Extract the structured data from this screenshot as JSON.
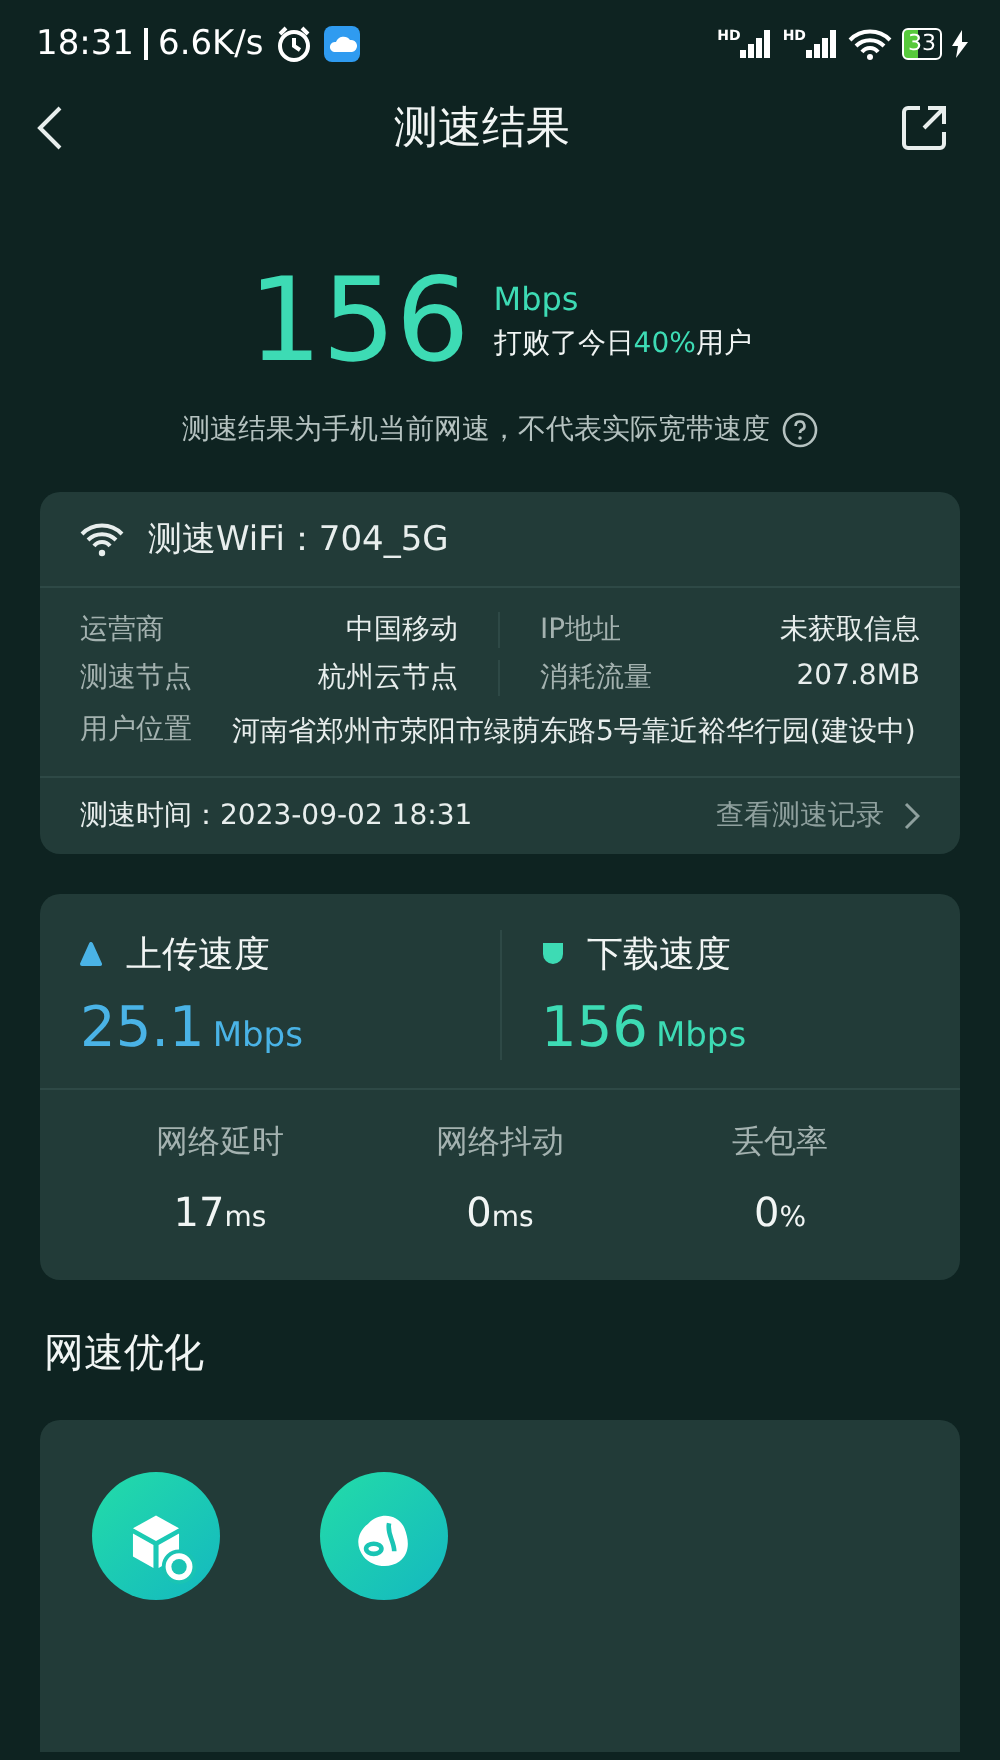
{
  "status_bar": {
    "time": "18:31",
    "speed": "6.6K/s",
    "signal_labels": [
      "HD",
      "HD"
    ],
    "battery": "33"
  },
  "header": {
    "title": "测速结果"
  },
  "result": {
    "value": "156",
    "unit": "Mbps",
    "rank": {
      "before": "打败了今日",
      "highlight": "40%",
      "after": "用户"
    },
    "note": "测速结果为手机当前网速，不代表实际宽带速度"
  },
  "wifi_card": {
    "wifi": "测速WiFi：704_5G",
    "details": [
      {
        "label": "运营商",
        "value": "中国移动"
      },
      {
        "label": "IP地址",
        "value": "未获取信息"
      },
      {
        "label": "测速节点",
        "value": "杭州云节点"
      },
      {
        "label": "消耗流量",
        "value": "207.8MB"
      }
    ],
    "location": {
      "label": "用户位置",
      "value": "河南省郑州市荥阳市绿荫东路5号靠近裕华行园(建设中)"
    },
    "time": "测速时间：2023-09-02 18:31",
    "history_link": "查看测速记录"
  },
  "speed_card": {
    "speeds": [
      {
        "kind": "upload",
        "label": "上传速度",
        "value": "25.1",
        "unit": "Mbps",
        "color": "#4ab3e6"
      },
      {
        "kind": "download",
        "label": "下载速度",
        "value": "156",
        "unit": "Mbps",
        "color": "#3ddbb4"
      }
    ],
    "metrics": [
      {
        "label": "网络延时",
        "value": "17",
        "unit": "ms"
      },
      {
        "label": "网络抖动",
        "value": "0",
        "unit": "ms"
      },
      {
        "label": "丢包率",
        "value": "0",
        "unit": "%"
      }
    ]
  },
  "optimize": {
    "title": "网速优化",
    "tools": [
      {
        "kind": "ap"
      },
      {
        "kind": "map"
      }
    ]
  }
}
